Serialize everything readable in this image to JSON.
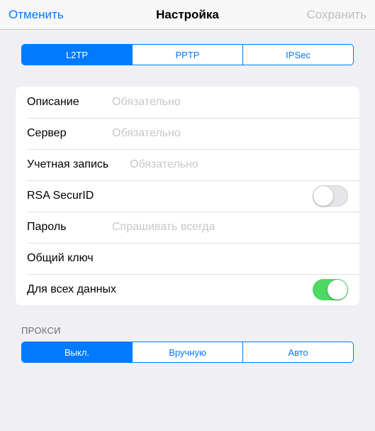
{
  "header": {
    "cancel": "Отменить",
    "title": "Настройка",
    "save": "Сохранить"
  },
  "vpn_type_tabs": [
    {
      "label": "L2TP",
      "active": true
    },
    {
      "label": "PPTP",
      "active": false
    },
    {
      "label": "IPSec",
      "active": false
    }
  ],
  "fields": {
    "description": {
      "label": "Описание",
      "placeholder": "Обязательно",
      "value": ""
    },
    "server": {
      "label": "Сервер",
      "placeholder": "Обязательно",
      "value": ""
    },
    "account": {
      "label": "Учетная запись",
      "placeholder": "Обязательно",
      "value": ""
    },
    "rsa": {
      "label": "RSA SecurID",
      "on": false
    },
    "password": {
      "label": "Пароль",
      "placeholder": "Спрашивать всегда",
      "value": ""
    },
    "shared_key": {
      "label": "Общий ключ",
      "placeholder": "",
      "value": ""
    },
    "all_traffic": {
      "label": "Для всех данных",
      "on": true
    }
  },
  "proxy": {
    "header": "ПРОКСИ",
    "tabs": [
      {
        "label": "Выкл.",
        "active": true
      },
      {
        "label": "Вручную",
        "active": false
      },
      {
        "label": "Авто",
        "active": false
      }
    ]
  }
}
